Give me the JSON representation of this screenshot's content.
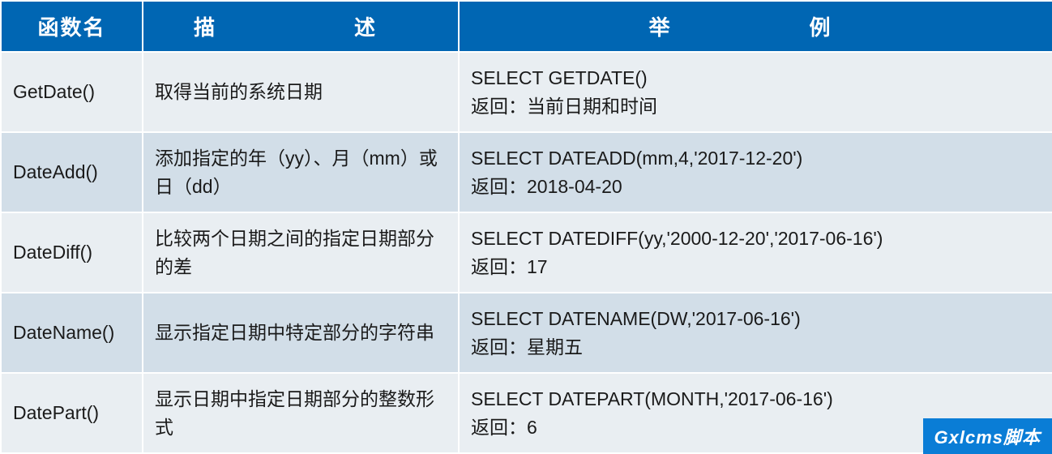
{
  "headers": {
    "fn": "函数名",
    "desc": "描　　述",
    "ex": "举　　例"
  },
  "rows": [
    {
      "fn": "GetDate()",
      "desc": "取得当前的系统日期",
      "ex": "SELECT GETDATE()\n返回：当前日期和时间"
    },
    {
      "fn": "DateAdd()",
      "desc": "添加指定的年（yy）、月（mm）或日（dd）",
      "ex": "SELECT DATEADD(mm,4,'2017-12-20')\n返回：2018-04-20"
    },
    {
      "fn": "DateDiff()",
      "desc": "比较两个日期之间的指定日期部分的差",
      "ex": "SELECT DATEDIFF(yy,'2000-12-20','2017-06-16')\n返回：17"
    },
    {
      "fn": "DateName()",
      "desc": "显示指定日期中特定部分的字符串",
      "ex": "SELECT DATENAME(DW,'2017-06-16')\n返回：星期五"
    },
    {
      "fn": "DatePart()",
      "desc": "显示日期中指定日期部分的整数形式",
      "ex": "SELECT DATEPART(MONTH,'2017-06-16')\n返回：6"
    }
  ],
  "watermark": "Gxlcms脚本"
}
